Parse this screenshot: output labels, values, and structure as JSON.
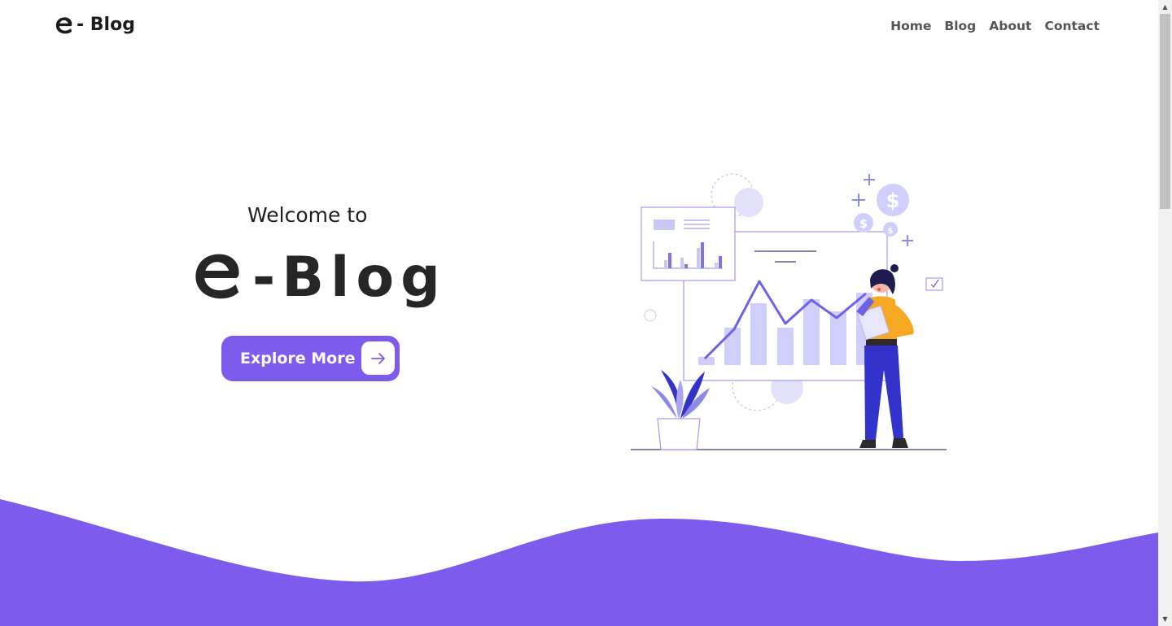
{
  "header": {
    "logo_text": "- Blog",
    "nav": [
      {
        "label": "Home"
      },
      {
        "label": "Blog"
      },
      {
        "label": "About"
      },
      {
        "label": "Contact"
      }
    ]
  },
  "hero": {
    "welcome": "Welcome to",
    "brand_text": "-Blog",
    "cta_label": "Explore More",
    "cta_icon": "arrow-right-icon"
  },
  "colors": {
    "accent": "#7e5bec",
    "text_dark": "#222222",
    "illustration_primary": "#6c63ff",
    "illustration_light": "#d6d4fb",
    "figure_shirt": "#f9a825",
    "figure_pants": "#3333cc"
  },
  "scrollbar": {
    "up_icon": "scroll-up-arrow-icon",
    "down_icon": "scroll-down-arrow-icon"
  }
}
